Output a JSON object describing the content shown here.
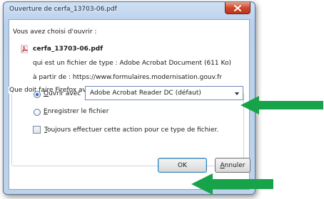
{
  "window": {
    "title": "Ouverture de cerfa_13703-06.pdf"
  },
  "prompt": "Vous avez choisi d'ouvrir :",
  "file": {
    "name": "cerfa_13703-06.pdf",
    "type_line": "qui est un fichier de type : Adobe Acrobat Document (611 Ko)",
    "from_line": "à partir de : https://www.formulaires.modernisation.gouv.fr"
  },
  "action_group": {
    "legend": "Que doit faire Firefox avec ce fichier ?",
    "open_with": {
      "label_key": "O",
      "label_rest": "uvrir avec",
      "selected": true,
      "app": "Adobe Acrobat Reader DC  (défaut)"
    },
    "save_file": {
      "label_key": "E",
      "label_rest": "nregistrer le fichier",
      "selected": false
    },
    "always": {
      "label_key": "T",
      "label_rest": "oujours effectuer cette action pour ce type de fichier.",
      "checked": false
    }
  },
  "buttons": {
    "ok": "OK",
    "cancel_key": "A",
    "cancel_rest": "nnuler"
  },
  "colors": {
    "annotation_arrow": "#16a34a"
  }
}
